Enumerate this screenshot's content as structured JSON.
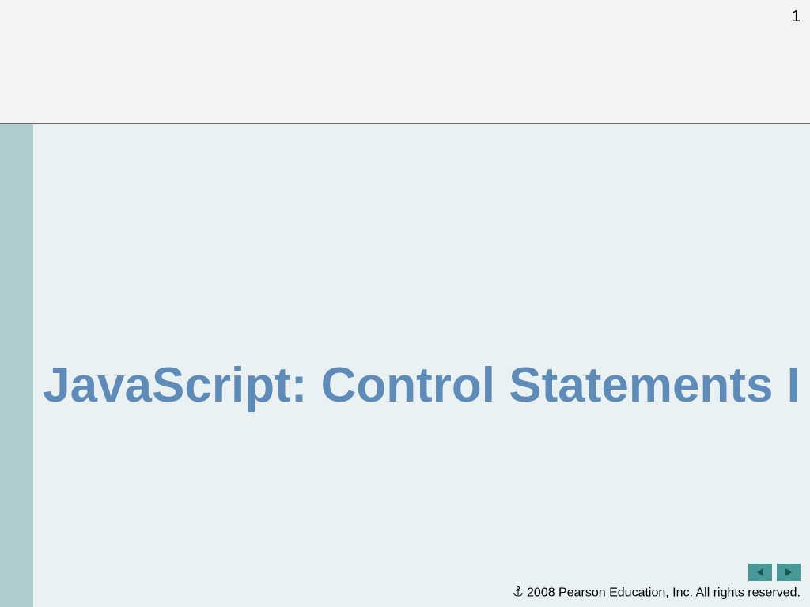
{
  "slide": {
    "page_number": "1",
    "title": "JavaScript: Control Statements I",
    "copyright": "2008 Pearson Education, Inc.  All rights reserved."
  }
}
